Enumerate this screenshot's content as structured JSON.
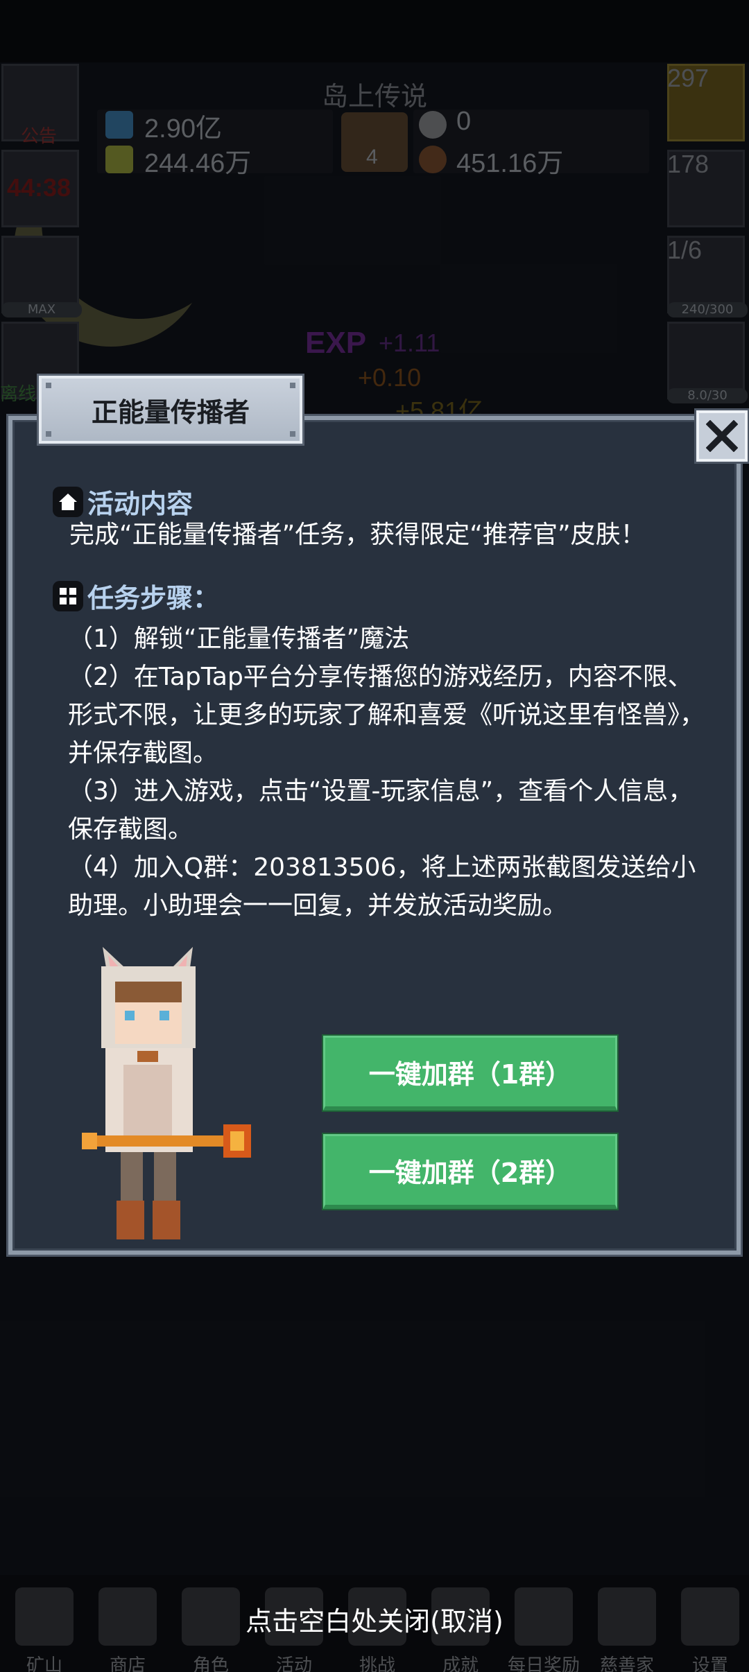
{
  "background": {
    "island_title": "岛上传说",
    "resources": {
      "gem": "2.90亿",
      "potion": "244.46万",
      "book_count": "4",
      "coin": "0",
      "ore": "451.16万"
    },
    "left_slots": {
      "notice_label": "公告",
      "timer": "44:38",
      "max_label": "MAX",
      "offline_label": "离线"
    },
    "right_slots": {
      "potion_count": "297",
      "chest_count": "178",
      "slime_count": "1/6",
      "slime_bar": "240/300",
      "sword_bar": "8.0/30"
    },
    "exp": {
      "label": "EXP",
      "exp_gain": "+1.11",
      "mid_gain": "+0.10",
      "gold_gain": "+5.81亿"
    },
    "nav": [
      {
        "label": "矿山",
        "icon": "lantern-icon"
      },
      {
        "label": "商店",
        "icon": "ore-icon"
      },
      {
        "label": "角色",
        "icon": "skull-icon"
      },
      {
        "label": "活动",
        "icon": "torch-icon"
      },
      {
        "label": "挑战",
        "icon": "spade-icon"
      },
      {
        "label": "成就",
        "icon": "medal-icon"
      },
      {
        "label": "每日奖励",
        "icon": "letter-icon"
      },
      {
        "label": "慈善家",
        "icon": "bread-icon"
      },
      {
        "label": "设置",
        "icon": "gear-icon"
      }
    ]
  },
  "dialog": {
    "title": "正能量传播者",
    "section1_title": "活动内容",
    "section1_body": "完成“正能量传播者”任务，获得限定“推荐官”皮肤！",
    "section2_title": "任务步骤：",
    "steps": [
      "（1）解锁“正能量传播者”魔法",
      "（2）在TapTap平台分享传播您的游戏经历，内容不限、形式不限，让更多的玩家了解和喜爱《听说这里有怪兽》，并保存截图。",
      "（3）进入游戏，点击“设置-玩家信息”，查看个人信息，保存截图。",
      "（4）加入Q群：203813506，将上述两张截图发送给小助理。小助理会一一回复，并发放活动奖励。"
    ],
    "button1_label": "一键加群（1群）",
    "button2_label": "一键加群（2群）"
  },
  "footer_hint": "点击空白处关闭(取消)",
  "colors": {
    "dialog_bg": "#28313e",
    "section_title": "#b8d2ee",
    "button_green": "#43b56a"
  }
}
